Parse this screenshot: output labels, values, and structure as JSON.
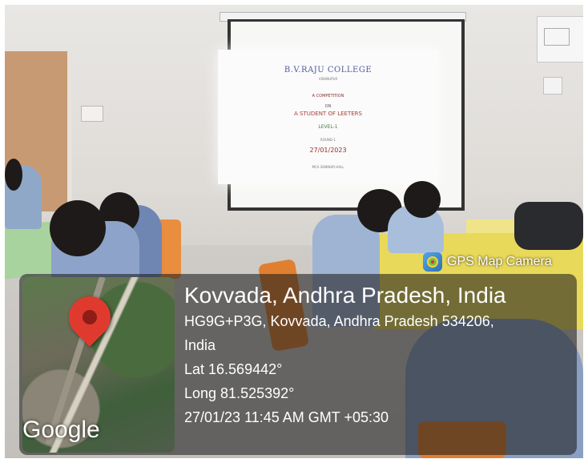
{
  "slide": {
    "college": "B.V.RAJU COLLEGE",
    "place": "VISHNUPUR",
    "kind": "A COMPETITION",
    "on": "ON",
    "topic": "A STUDENT OF LEETERS",
    "level": "LEVEL-1",
    "round": "ROUND-1",
    "date": "27/01/2023",
    "venue": "MCA SEMINAR HALL"
  },
  "overlay": {
    "app_name": "GPS Map Camera",
    "app_icon": "gps-map-camera-icon",
    "map_logo": "Google",
    "pin_icon": "map-pin-icon",
    "pin_color": "#e03a2f",
    "location_title": "Kovvada, Andhra Pradesh, India",
    "address_line1": "HG9G+P3G, Kovvada, Andhra Pradesh 534206,",
    "address_line2": "India",
    "latitude": "Lat 16.569442°",
    "longitude": "Long 81.525392°",
    "timestamp": "27/01/23 11:45 AM GMT +05:30"
  }
}
